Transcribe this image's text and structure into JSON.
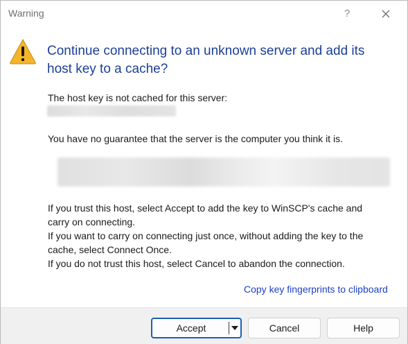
{
  "window": {
    "title": "Warning",
    "help_glyph": "?",
    "close_icon": "close-icon"
  },
  "icon": "warning-triangle-icon",
  "heading": "Continue connecting to an unknown server and add its host key to a cache?",
  "messages": {
    "not_cached": "The host key is not cached for this server:",
    "no_guarantee": "You have no guarantee that the server is the computer you think it is."
  },
  "instructions": [
    "If you trust this host, select Accept to add the key to WinSCP's cache and",
    "carry on connecting.",
    "If you want to carry on connecting just once, without adding the key to the",
    "cache, select Connect Once.",
    "If you do not trust this host, select Cancel to abandon the connection."
  ],
  "link": "Copy key fingerprints to clipboard",
  "buttons": {
    "accept": "Accept",
    "cancel": "Cancel",
    "help": "Help"
  },
  "colors": {
    "heading": "#1c3f94",
    "link": "#1d3fc2",
    "default_button_border": "#1b5fb8",
    "warning_fill": "#f5b52a"
  }
}
